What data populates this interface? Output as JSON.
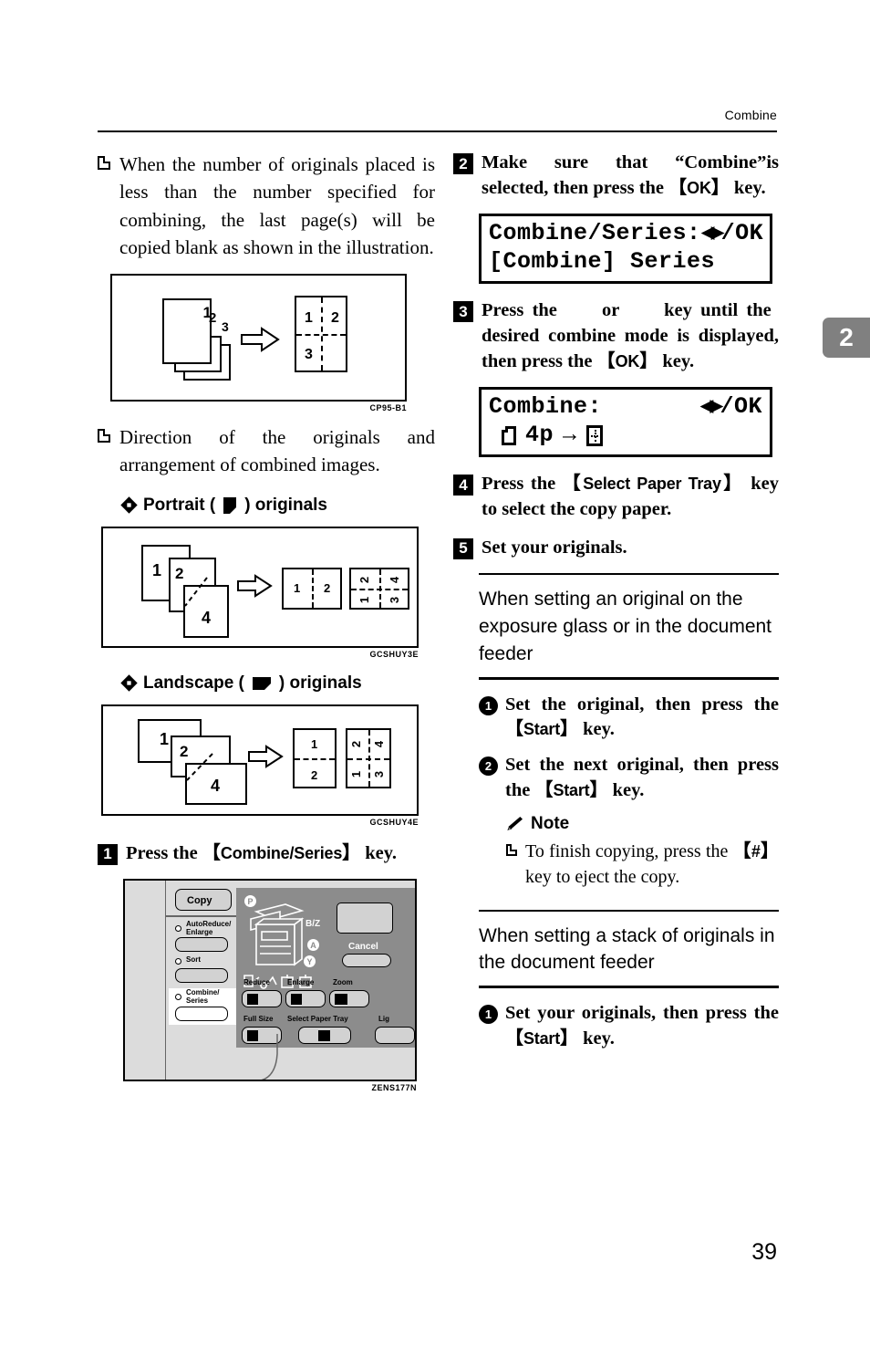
{
  "header": {
    "title": "Combine"
  },
  "chapter_tab": {
    "number": "2"
  },
  "page_number": "39",
  "left_column": {
    "bullet_1": "When the number of originals placed is less than the number specified for combining, the last page(s) will be copied blank as shown in the illustration.",
    "figure_1": {
      "caption": "CP95-B1",
      "originals": [
        "1",
        "2",
        "3"
      ],
      "output_cells": [
        "1",
        "2",
        "3",
        ""
      ]
    },
    "bullet_2": "Direction of the originals and arrangement of combined images.",
    "portrait_heading": {
      "prefix": "Portrait (",
      "suffix": ") originals",
      "icon": "portrait-page-icon"
    },
    "figure_portrait": {
      "caption": "GCSHUY3E",
      "originals": [
        "1",
        "2",
        "4"
      ],
      "output_a_cells": [
        "1",
        "2"
      ],
      "output_b_cells": [
        "2",
        "4",
        "1",
        "3"
      ]
    },
    "landscape_heading": {
      "prefix": "Landscape (",
      "suffix": ") originals",
      "icon": "landscape-page-icon"
    },
    "figure_landscape": {
      "caption": "GCSHUY4E",
      "originals": [
        "1",
        "2",
        "4"
      ],
      "output_a_cells": [
        "1",
        "2"
      ],
      "output_b_cells": [
        "2",
        "4",
        "1",
        "3"
      ]
    },
    "step_1": {
      "num": "1",
      "text_before": "Press the ",
      "key": "Combine/Series",
      "text_after": " key."
    },
    "figure_panel": {
      "caption": "ZENS177N",
      "buttons": {
        "copy": "Copy",
        "auto_reduce_enlarge": "AutoReduce/\nEnlarge",
        "sort": "Sort",
        "combine_series": "Combine/\nSeries",
        "reduce": "Reduce",
        "enlarge": "Enlarge",
        "zoom": "Zoom",
        "full_size": "Full Size",
        "select_paper_tray": "Select Paper Tray",
        "cancel": "Cancel",
        "lighter": "Lig"
      },
      "diagram_labels": [
        "P",
        "B/Z",
        "A",
        "Y"
      ]
    }
  },
  "right_column": {
    "step_2": {
      "num": "2",
      "text_before": "Make sure that “Combine”is selected, then press the ",
      "key": "OK",
      "text_after": " key."
    },
    "lcd_1": {
      "line1_left": "Combine/Series:",
      "line1_right": "/OK",
      "line2": "[Combine] Series"
    },
    "step_3": {
      "num": "3",
      "text_before": "Press the ",
      "key_left": "left-arrow-key-icon",
      "text_mid": " or ",
      "key_right": "right-arrow-key-icon",
      "text_mid2": " key until the desired combine mode is displayed, then press the ",
      "key": "OK",
      "text_after": " key."
    },
    "lcd_2": {
      "line1_left": "Combine:",
      "line1_right": "/OK",
      "line2_text": "4p",
      "line2_arrow": "→"
    },
    "step_4": {
      "num": "4",
      "text_before": "Press the ",
      "key": "Select Paper Tray",
      "text_after": " key to select the copy paper."
    },
    "step_5": {
      "num": "5",
      "text": "Set your originals."
    },
    "section_1": {
      "heading": "When setting an original on the exposure glass or in the document feeder",
      "substep_1": {
        "num": "❶",
        "text_before": "Set the original, then press the ",
        "key": "Start",
        "text_after": " key."
      },
      "substep_2": {
        "num": "❷",
        "text_before": "Set the next original, then press the ",
        "key": "Start",
        "text_after": " key."
      },
      "note": {
        "label": "Note",
        "icon": "pencil-icon",
        "text_before": "To finish copying, press the ",
        "key": "#",
        "text_after": " key to eject the copy."
      }
    },
    "section_2": {
      "heading": "When setting a stack of originals in the document feeder",
      "substep_1": {
        "num": "❶",
        "text_before": "Set your originals, then press the ",
        "key": "Start",
        "text_after": " key."
      }
    }
  }
}
